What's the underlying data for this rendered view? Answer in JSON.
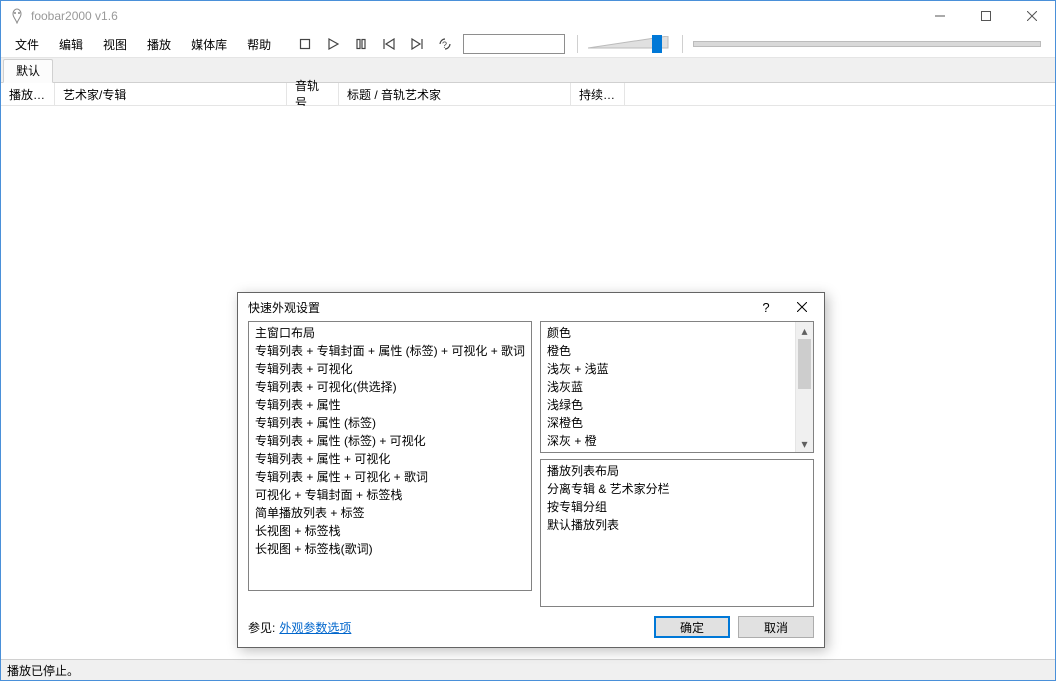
{
  "window": {
    "title": "foobar2000 v1.6"
  },
  "menu": {
    "items": [
      "文件",
      "编辑",
      "视图",
      "播放",
      "媒体库",
      "帮助"
    ]
  },
  "tabstrip": {
    "tabs": [
      "默认"
    ]
  },
  "columns": {
    "c1": "播放…",
    "c2": "艺术家/专辑",
    "c3": "音轨号",
    "c4": "标题 / 音轨艺术家",
    "c5": "持续…"
  },
  "statusbar": {
    "text": "播放已停止。"
  },
  "dialog": {
    "title": "快速外观设置",
    "left": {
      "header": "主窗口布局",
      "items": [
        "专辑列表 + 专辑封面 + 属性 (标签) + 可视化 + 歌词",
        "专辑列表 + 可视化",
        "专辑列表 + 可视化(供选择)",
        "专辑列表 + 属性",
        "专辑列表 + 属性 (标签)",
        "专辑列表 + 属性 (标签) + 可视化",
        "专辑列表 + 属性 + 可视化",
        "专辑列表 + 属性 + 可视化 + 歌词",
        "可视化 + 专辑封面 + 标签栈",
        "简单播放列表 + 标签",
        "长视图 + 标签栈",
        "长视图 + 标签栈(歌词)"
      ]
    },
    "right1": {
      "header": "颜色",
      "items": [
        "橙色",
        "浅灰 + 浅蓝",
        "浅灰蓝",
        "浅绿色",
        "深橙色",
        "深灰 + 橙"
      ]
    },
    "right2": {
      "header": "播放列表布局",
      "items": [
        "分离专辑 & 艺术家分栏",
        "按专辑分组",
        "默认播放列表"
      ]
    },
    "footer": {
      "seealso_label": "参见:",
      "link": "外观参数选项",
      "ok": "确定",
      "cancel": "取消"
    }
  }
}
